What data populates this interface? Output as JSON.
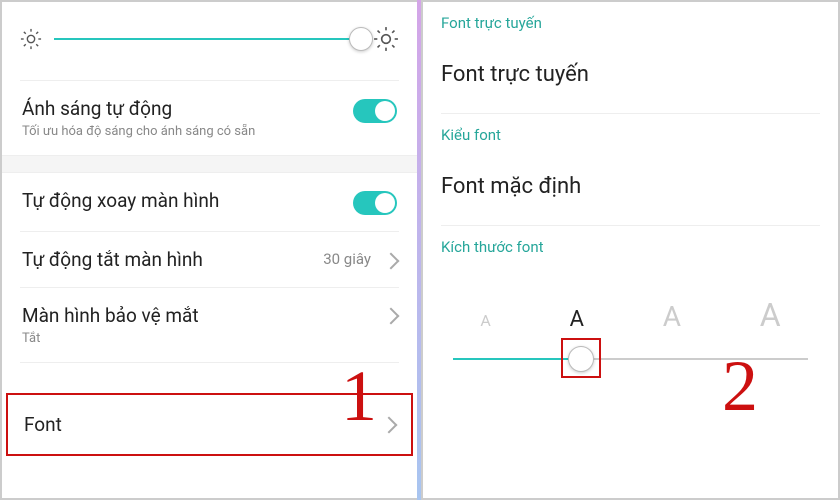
{
  "left": {
    "auto_light": {
      "title": "Ánh sáng tự động",
      "sub": "Tối ưu hóa độ sáng cho ánh sáng có sẵn"
    },
    "auto_rotate": {
      "title": "Tự động xoay màn hình"
    },
    "auto_off": {
      "title": "Tự động tắt màn hình",
      "value": "30 giây"
    },
    "eye_protect": {
      "title": "Màn hình bảo vệ mắt",
      "sub": "Tắt"
    },
    "font_row": {
      "title": "Font"
    }
  },
  "right": {
    "online_header": "Font trực tuyến",
    "online_label": "Font trực tuyến",
    "style_header": "Kiểu font",
    "style_label": "Font mặc định",
    "size_header": "Kích thước font",
    "preview": [
      "A",
      "A",
      "A",
      "A"
    ]
  },
  "annotations": {
    "one": "1",
    "two": "2"
  }
}
